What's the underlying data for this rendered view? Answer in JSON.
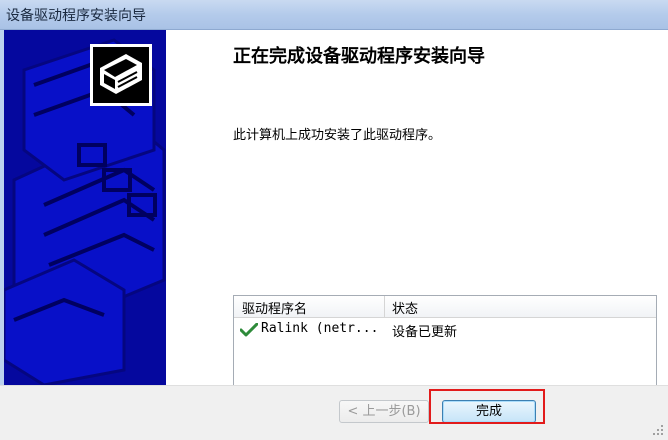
{
  "window": {
    "title": "设备驱动程序安装向导"
  },
  "wizard": {
    "heading": "正在完成设备驱动程序安装向导",
    "message": "此计算机上成功安装了此驱动程序。"
  },
  "driver_list": {
    "columns": [
      "驱动程序名",
      "状态"
    ],
    "rows": [
      {
        "icon": "green-checkmark-icon",
        "name": "Ralink (netr...",
        "status": "设备已更新"
      }
    ]
  },
  "buttons": {
    "back": "< 上一步(B)",
    "finish": "完成"
  },
  "colors": {
    "banner": "#05089e",
    "highlight": "#e21b1b",
    "check": "#2e8b3a"
  }
}
